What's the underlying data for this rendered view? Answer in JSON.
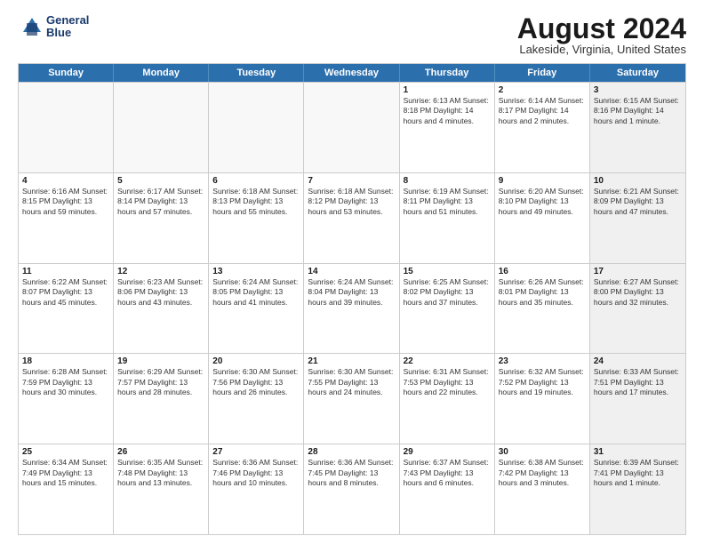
{
  "header": {
    "logo_line1": "General",
    "logo_line2": "Blue",
    "month_title": "August 2024",
    "location": "Lakeside, Virginia, United States"
  },
  "days_of_week": [
    "Sunday",
    "Monday",
    "Tuesday",
    "Wednesday",
    "Thursday",
    "Friday",
    "Saturday"
  ],
  "rows": [
    [
      {
        "num": "",
        "info": "",
        "empty": true
      },
      {
        "num": "",
        "info": "",
        "empty": true
      },
      {
        "num": "",
        "info": "",
        "empty": true
      },
      {
        "num": "",
        "info": "",
        "empty": true
      },
      {
        "num": "1",
        "info": "Sunrise: 6:13 AM\nSunset: 8:18 PM\nDaylight: 14 hours\nand 4 minutes."
      },
      {
        "num": "2",
        "info": "Sunrise: 6:14 AM\nSunset: 8:17 PM\nDaylight: 14 hours\nand 2 minutes."
      },
      {
        "num": "3",
        "info": "Sunrise: 6:15 AM\nSunset: 8:16 PM\nDaylight: 14 hours\nand 1 minute.",
        "shaded": true
      }
    ],
    [
      {
        "num": "4",
        "info": "Sunrise: 6:16 AM\nSunset: 8:15 PM\nDaylight: 13 hours\nand 59 minutes."
      },
      {
        "num": "5",
        "info": "Sunrise: 6:17 AM\nSunset: 8:14 PM\nDaylight: 13 hours\nand 57 minutes."
      },
      {
        "num": "6",
        "info": "Sunrise: 6:18 AM\nSunset: 8:13 PM\nDaylight: 13 hours\nand 55 minutes."
      },
      {
        "num": "7",
        "info": "Sunrise: 6:18 AM\nSunset: 8:12 PM\nDaylight: 13 hours\nand 53 minutes."
      },
      {
        "num": "8",
        "info": "Sunrise: 6:19 AM\nSunset: 8:11 PM\nDaylight: 13 hours\nand 51 minutes."
      },
      {
        "num": "9",
        "info": "Sunrise: 6:20 AM\nSunset: 8:10 PM\nDaylight: 13 hours\nand 49 minutes."
      },
      {
        "num": "10",
        "info": "Sunrise: 6:21 AM\nSunset: 8:09 PM\nDaylight: 13 hours\nand 47 minutes.",
        "shaded": true
      }
    ],
    [
      {
        "num": "11",
        "info": "Sunrise: 6:22 AM\nSunset: 8:07 PM\nDaylight: 13 hours\nand 45 minutes."
      },
      {
        "num": "12",
        "info": "Sunrise: 6:23 AM\nSunset: 8:06 PM\nDaylight: 13 hours\nand 43 minutes."
      },
      {
        "num": "13",
        "info": "Sunrise: 6:24 AM\nSunset: 8:05 PM\nDaylight: 13 hours\nand 41 minutes."
      },
      {
        "num": "14",
        "info": "Sunrise: 6:24 AM\nSunset: 8:04 PM\nDaylight: 13 hours\nand 39 minutes."
      },
      {
        "num": "15",
        "info": "Sunrise: 6:25 AM\nSunset: 8:02 PM\nDaylight: 13 hours\nand 37 minutes."
      },
      {
        "num": "16",
        "info": "Sunrise: 6:26 AM\nSunset: 8:01 PM\nDaylight: 13 hours\nand 35 minutes."
      },
      {
        "num": "17",
        "info": "Sunrise: 6:27 AM\nSunset: 8:00 PM\nDaylight: 13 hours\nand 32 minutes.",
        "shaded": true
      }
    ],
    [
      {
        "num": "18",
        "info": "Sunrise: 6:28 AM\nSunset: 7:59 PM\nDaylight: 13 hours\nand 30 minutes."
      },
      {
        "num": "19",
        "info": "Sunrise: 6:29 AM\nSunset: 7:57 PM\nDaylight: 13 hours\nand 28 minutes."
      },
      {
        "num": "20",
        "info": "Sunrise: 6:30 AM\nSunset: 7:56 PM\nDaylight: 13 hours\nand 26 minutes."
      },
      {
        "num": "21",
        "info": "Sunrise: 6:30 AM\nSunset: 7:55 PM\nDaylight: 13 hours\nand 24 minutes."
      },
      {
        "num": "22",
        "info": "Sunrise: 6:31 AM\nSunset: 7:53 PM\nDaylight: 13 hours\nand 22 minutes."
      },
      {
        "num": "23",
        "info": "Sunrise: 6:32 AM\nSunset: 7:52 PM\nDaylight: 13 hours\nand 19 minutes."
      },
      {
        "num": "24",
        "info": "Sunrise: 6:33 AM\nSunset: 7:51 PM\nDaylight: 13 hours\nand 17 minutes.",
        "shaded": true
      }
    ],
    [
      {
        "num": "25",
        "info": "Sunrise: 6:34 AM\nSunset: 7:49 PM\nDaylight: 13 hours\nand 15 minutes."
      },
      {
        "num": "26",
        "info": "Sunrise: 6:35 AM\nSunset: 7:48 PM\nDaylight: 13 hours\nand 13 minutes."
      },
      {
        "num": "27",
        "info": "Sunrise: 6:36 AM\nSunset: 7:46 PM\nDaylight: 13 hours\nand 10 minutes."
      },
      {
        "num": "28",
        "info": "Sunrise: 6:36 AM\nSunset: 7:45 PM\nDaylight: 13 hours\nand 8 minutes."
      },
      {
        "num": "29",
        "info": "Sunrise: 6:37 AM\nSunset: 7:43 PM\nDaylight: 13 hours\nand 6 minutes."
      },
      {
        "num": "30",
        "info": "Sunrise: 6:38 AM\nSunset: 7:42 PM\nDaylight: 13 hours\nand 3 minutes."
      },
      {
        "num": "31",
        "info": "Sunrise: 6:39 AM\nSunset: 7:41 PM\nDaylight: 13 hours\nand 1 minute.",
        "shaded": true
      }
    ]
  ]
}
